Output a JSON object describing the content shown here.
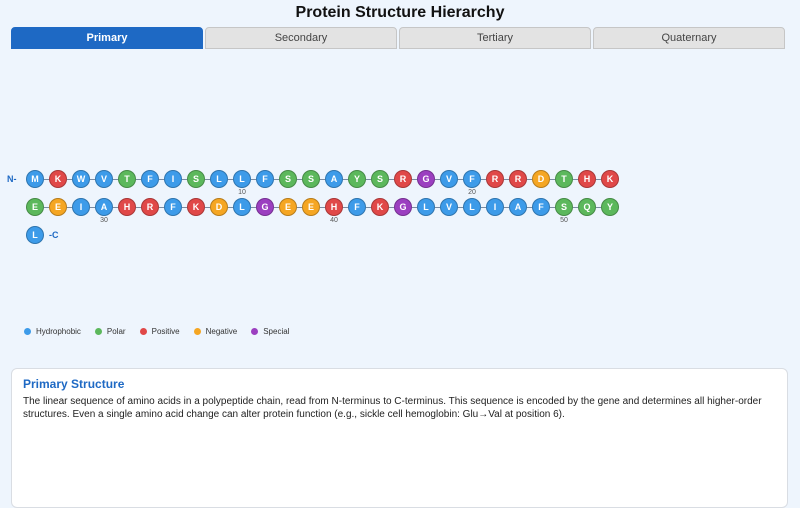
{
  "title": "Protein Structure Hierarchy",
  "tabs": [
    {
      "label": "Primary",
      "active": true
    },
    {
      "label": "Secondary",
      "active": false
    },
    {
      "label": "Tertiary",
      "active": false
    },
    {
      "label": "Quaternary",
      "active": false
    }
  ],
  "sequence": {
    "n_terminus": "N-",
    "c_terminus": "-C",
    "residues": [
      "M",
      "K",
      "W",
      "V",
      "T",
      "F",
      "I",
      "S",
      "L",
      "L",
      "F",
      "S",
      "S",
      "A",
      "Y",
      "S",
      "R",
      "G",
      "V",
      "F",
      "R",
      "R",
      "D",
      "T",
      "H",
      "K",
      "E",
      "E",
      "I",
      "A",
      "H",
      "R",
      "F",
      "K",
      "D",
      "L",
      "G",
      "E",
      "E",
      "H",
      "F",
      "K",
      "G",
      "L",
      "V",
      "L",
      "I",
      "A",
      "F",
      "S",
      "Q",
      "Y",
      "L"
    ],
    "classes": [
      "hydrophobic",
      "positive",
      "hydrophobic",
      "hydrophobic",
      "polar",
      "hydrophobic",
      "hydrophobic",
      "polar",
      "hydrophobic",
      "hydrophobic",
      "hydrophobic",
      "polar",
      "polar",
      "hydrophobic",
      "polar",
      "polar",
      "positive",
      "special",
      "hydrophobic",
      "hydrophobic",
      "positive",
      "positive",
      "negative",
      "polar",
      "positive",
      "positive",
      "polar",
      "negative",
      "hydrophobic",
      "hydrophobic",
      "positive",
      "positive",
      "hydrophobic",
      "positive",
      "negative",
      "hydrophobic",
      "special",
      "negative",
      "negative",
      "positive",
      "hydrophobic",
      "positive",
      "special",
      "hydrophobic",
      "hydrophobic",
      "hydrophobic",
      "hydrophobic",
      "hydrophobic",
      "hydrophobic",
      "polar",
      "polar",
      "polar",
      "hydrophobic"
    ],
    "position_markers": [
      "10",
      "20",
      "30",
      "40",
      "50"
    ]
  },
  "legend": [
    {
      "label": "Hydrophobic",
      "class": "hydrophobic"
    },
    {
      "label": "Polar",
      "class": "polar"
    },
    {
      "label": "Positive",
      "class": "positive"
    },
    {
      "label": "Negative",
      "class": "negative"
    },
    {
      "label": "Special",
      "class": "special"
    }
  ],
  "colors": {
    "hydrophobic": "#3d9be9",
    "polar": "#5cb85c",
    "positive": "#e04848",
    "negative": "#f5a623",
    "special": "#9b3fc0"
  },
  "info": {
    "heading": "Primary Structure",
    "body": "The linear sequence of amino acids in a polypeptide chain, read from N-terminus to C-terminus. This sequence is encoded by the gene and determines all higher-order structures. Even a single amino acid change can alter protein function (e.g., sickle cell hemoglobin: Glu→Val at position 6)."
  }
}
